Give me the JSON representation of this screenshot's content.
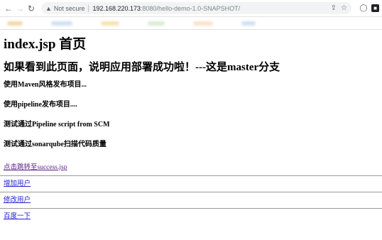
{
  "browser": {
    "not_secure": "Not secure",
    "url_host": "192.168.220.173",
    "url_path": ":8080/hello-demo-1.0-SNAPSHOT/"
  },
  "page": {
    "heading1": "index.jsp 首页",
    "heading2": "如果看到此页面，说明应用部署成功啦！---这是master分支",
    "lines": [
      "使用Maven风格发布项目...",
      "使用pipeline发布项目....",
      "测试通过Pipeline script from SCM",
      "测试通过sonarqube扫描代码质量"
    ],
    "links": [
      "点击跳转至success.jsp",
      "增加用户",
      "修改用户",
      "百度一下"
    ]
  }
}
